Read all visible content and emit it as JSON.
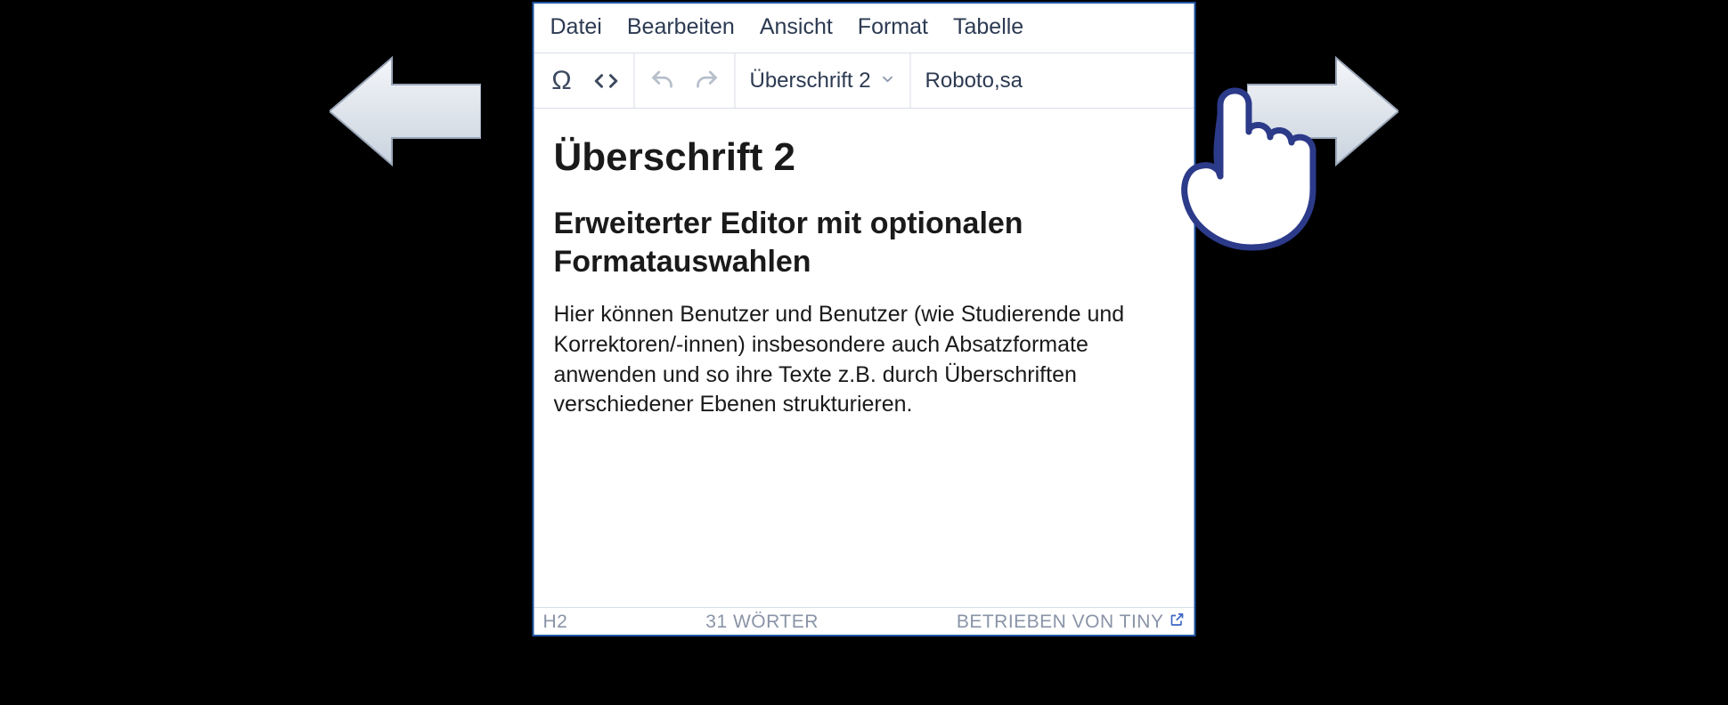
{
  "menu": {
    "file": "Datei",
    "edit": "Bearbeiten",
    "view": "Ansicht",
    "format": "Format",
    "table": "Tabelle"
  },
  "toolbar": {
    "special_char": "Ω",
    "block_format": "Überschrift 2",
    "font_family": "Roboto,sa"
  },
  "content": {
    "heading": "Überschrift 2",
    "subheading": "Erweiterter Editor mit optionalen Formatauswahlen",
    "paragraph": "Hier können Benutzer und Benutzer (wie Studierende und Korrektoren/-innen) insbesondere auch Absatzformate anwenden und so ihre Texte z.B. durch Überschriften verschiedener Ebenen strukturieren."
  },
  "status": {
    "path": "H2",
    "wordcount": "31 WÖRTER",
    "powered": "BETRIEBEN VON TINY"
  }
}
